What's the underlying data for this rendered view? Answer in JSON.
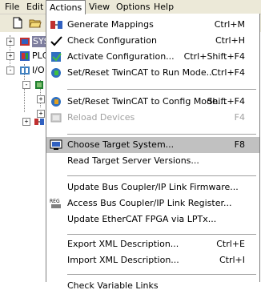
{
  "menubar": {
    "items": [
      {
        "label": "File"
      },
      {
        "label": "Edit"
      },
      {
        "label": "Actions"
      },
      {
        "label": "View"
      },
      {
        "label": "Options"
      },
      {
        "label": "Help"
      }
    ],
    "active": "Actions"
  },
  "tree": {
    "rows": [
      {
        "label": "SYS",
        "icon": "system-config-icon",
        "expander": "+"
      },
      {
        "label": "PLC",
        "icon": "plc-config-icon",
        "expander": "+"
      },
      {
        "label": "I/O",
        "icon": "io-config-icon",
        "expander": "-"
      },
      {
        "label": "",
        "icon": "io-devices-icon",
        "expander": "-"
      },
      {
        "label": "",
        "icon": "device-icon",
        "expander": "+"
      },
      {
        "label": "",
        "icon": "device-icon",
        "expander": "+"
      },
      {
        "label": "",
        "icon": "mappings-icon",
        "expander": "+"
      }
    ]
  },
  "actions_menu": {
    "items": [
      {
        "label": "Generate Mappings",
        "accel_index": 9,
        "shortcut": "Ctrl+M",
        "icon": "generate-mappings-icon",
        "disabled": false
      },
      {
        "label": "Check Configuration",
        "accel_index": 0,
        "shortcut": "Ctrl+H",
        "icon": "checkmark-icon",
        "disabled": false
      },
      {
        "label": "Activate Configuration...",
        "accel_index": -1,
        "shortcut": "Ctrl+Shift+F4",
        "icon": "activate-config-icon",
        "disabled": false
      },
      {
        "label": "Set/Reset TwinCAT to Run Mode...",
        "accel_index": -1,
        "shortcut": "Ctrl+F4",
        "icon": "run-mode-icon",
        "disabled": false
      },
      {
        "separator": true
      },
      {
        "label": "Set/Reset TwinCAT to Config Mode...",
        "accel_index": -1,
        "shortcut": "Shift+F4",
        "icon": "config-mode-icon",
        "disabled": false
      },
      {
        "label": "Reload Devices",
        "accel_index": -1,
        "shortcut": "F4",
        "icon": "reload-devices-icon",
        "disabled": true
      },
      {
        "separator": true
      },
      {
        "label": "Choose Target System...",
        "accel_index": -1,
        "shortcut": "F8",
        "icon": "target-system-icon",
        "disabled": false,
        "highlighted": true
      },
      {
        "label": "Read Target Server Versions...",
        "accel_index": -1,
        "shortcut": "",
        "icon": "",
        "disabled": false
      },
      {
        "separator": true
      },
      {
        "label": "Update Bus Coupler/IP Link Firmware...",
        "accel_index": -1,
        "shortcut": "",
        "icon": "",
        "disabled": false
      },
      {
        "label": "Access Bus Coupler/IP Link Register...",
        "accel_index": -1,
        "shortcut": "",
        "icon": "register-icon",
        "disabled": false
      },
      {
        "label": "Update EtherCAT FPGA via LPTx...",
        "accel_index": -1,
        "shortcut": "",
        "icon": "",
        "disabled": false
      },
      {
        "separator": true
      },
      {
        "label": "Export XML Description...",
        "accel_index": -1,
        "shortcut": "Ctrl+E",
        "icon": "",
        "disabled": false
      },
      {
        "label": "Import XML Description...",
        "accel_index": -1,
        "shortcut": "Ctrl+I",
        "icon": "",
        "disabled": false
      },
      {
        "separator": true
      },
      {
        "label": "Check Variable Links",
        "accel_index": -1,
        "shortcut": "",
        "icon": "",
        "disabled": false
      }
    ]
  },
  "colors": {
    "menubar_bg": "#ece9d8",
    "highlight_bg": "#c1c1c1",
    "disabled_text": "#a0a0a0"
  }
}
